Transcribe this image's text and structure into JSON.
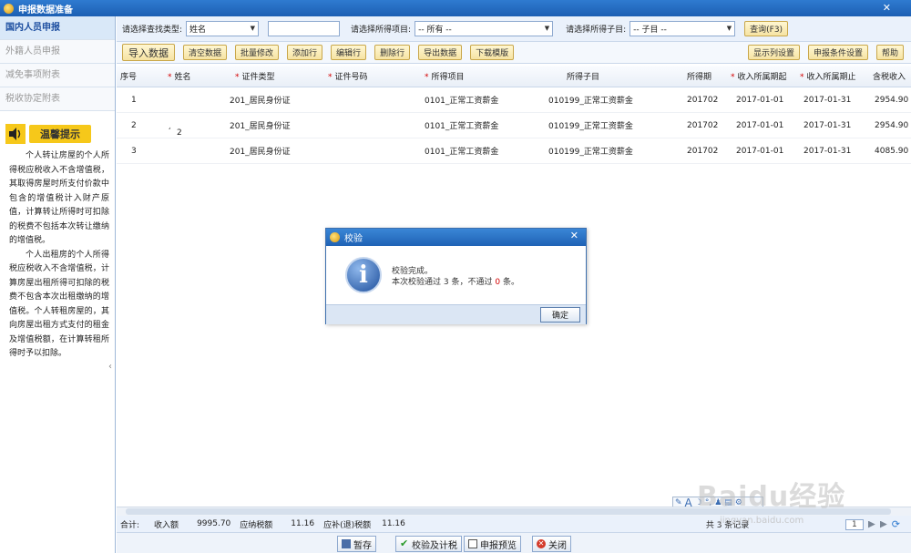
{
  "window": {
    "title": "申报数据准备"
  },
  "sidebar": {
    "items": [
      {
        "label": "国内人员申报",
        "active": true
      },
      {
        "label": "外籍人员申报",
        "active": false
      },
      {
        "label": "减免事项附表",
        "active": false
      },
      {
        "label": "税收协定附表",
        "active": false
      }
    ],
    "tips_title": "温馨提示",
    "tips": [
      "个人转让房屋的个人所得税应税收入不含增值税，其取得房屋时所支付价款中包含的增值税计入财产原值，计算转让所得时可扣除的税费不包括本次转让缴纳的增值税。",
      "个人出租房的个人所得税应税收入不含增值税，计算房屋出租所得可扣除的税费不包含本次出租缴纳的增值税。个人转租房屋的，其向房屋出租方式支付的租金及增值税额，在计算转租所得时予以扣除。"
    ]
  },
  "filters": {
    "search_type_label": "请选择查找类型:",
    "search_type_value": "姓名",
    "search_text": "",
    "income_item_label": "请选择所得项目:",
    "income_item_value": "-- 所有 --",
    "income_sub_label": "请选择所得子目:",
    "income_sub_value": "-- 子目 --",
    "query_button": "查询(F3)"
  },
  "toolbar": {
    "buttons": [
      "导入数据",
      "清空数据",
      "批量修改",
      "添加行",
      "编辑行",
      "删除行",
      "导出数据",
      "下载模版"
    ],
    "right_buttons": [
      "显示列设置",
      "申报条件设置",
      "帮助"
    ]
  },
  "table": {
    "columns": [
      "序号",
      "姓名",
      "证件类型",
      "证件号码",
      "所得项目",
      "所得子目",
      "所得期",
      "收入所属期起",
      "收入所属期止",
      "含税收入"
    ],
    "required": [
      false,
      true,
      true,
      true,
      true,
      false,
      false,
      true,
      true,
      false
    ],
    "rows": [
      {
        "no": "1",
        "name": "",
        "id_type": "201_居民身份证",
        "id_no": "",
        "item": "0101_正常工资薪金",
        "sub": "010199_正常工资薪金",
        "period": "201702",
        "start": "2017-01-01",
        "end": "2017-01-31",
        "income": "2954.90"
      },
      {
        "no": "2",
        "name": "",
        "id_type": "201_居民身份证",
        "id_no": "",
        "item": "0101_正常工资薪金",
        "sub": "010199_正常工资薪金",
        "period": "201702",
        "start": "2017-01-01",
        "end": "2017-01-31",
        "income": "2954.90"
      },
      {
        "no": "3",
        "name": "",
        "id_type": "201_居民身份证",
        "id_no": "",
        "item": "0101_正常工资薪金",
        "sub": "010199_正常工资薪金",
        "period": "201702",
        "start": "2017-01-01",
        "end": "2017-01-31",
        "income": "4085.90"
      }
    ],
    "stray_marks": [
      "¸",
      "2"
    ]
  },
  "totals": {
    "label": "合计:",
    "income_label": "收入额",
    "income_value": "9995.70",
    "payable_label": "应纳税额",
    "payable_value": "11.16",
    "refund_label": "应补(退)税额",
    "refund_value": "11.16",
    "record_label": "共 3 条记录"
  },
  "bottom_buttons": {
    "save": "暂存",
    "validate": "校验及计税",
    "preview": "申报预览",
    "close": "关闭"
  },
  "dialog": {
    "title": "校验",
    "line1": "校验完成。",
    "line2_prefix": "本次校验通过",
    "passed": "3",
    "line2_mid": "条，不通过",
    "failed": "0",
    "line2_suffix": "条。",
    "ok_button": "确定"
  },
  "watermark": {
    "text": "Baidu经验",
    "url": "jingyan.baidu.com"
  },
  "pager": {
    "page": "1"
  }
}
